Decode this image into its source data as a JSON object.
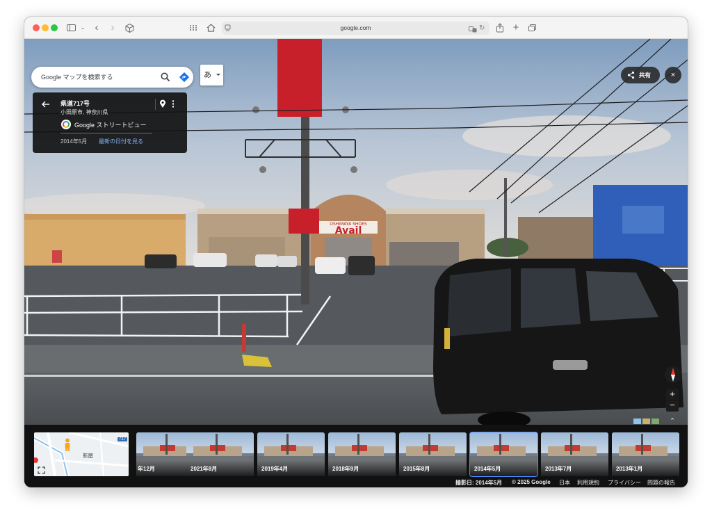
{
  "browser": {
    "url": "google.com"
  },
  "maps": {
    "search_placeholder": "Google マップを検索する",
    "ime_label": "あ",
    "share_label": "共有",
    "close_glyph": "×"
  },
  "location_card": {
    "title": "県道717号",
    "subtitle": "小田原市, 神奈川県",
    "brand": "Google ストリートビュー",
    "capture_date": "2014年5月",
    "latest_link": "最新の日付を見る"
  },
  "controls": {
    "zoom_in": "+",
    "zoom_out": "−",
    "expand_glyph": "⌃"
  },
  "minimap": {
    "place_label": "新屋",
    "road_number": "717"
  },
  "timeline": [
    {
      "label": "年12月",
      "selected": false
    },
    {
      "label": "2021年8月",
      "selected": false
    },
    {
      "label": "2019年4月",
      "selected": false
    },
    {
      "label": "2018年9月",
      "selected": false
    },
    {
      "label": "2015年8月",
      "selected": false
    },
    {
      "label": "2014年5月",
      "selected": true
    },
    {
      "label": "2013年7月",
      "selected": false
    },
    {
      "label": "2013年1月",
      "selected": false
    }
  ],
  "footer": {
    "capture": "撮影日: 2014年5月",
    "copyright": "© 2025 Google",
    "region": "日本",
    "terms": "利用規約",
    "privacy": "プライバシー",
    "report": "問題の報告"
  },
  "scene": {
    "store_sign_top": "OSHIMAYA SHOES",
    "store_sign": "Avail"
  },
  "colors": {
    "accent_blue": "#4a8cff",
    "link_blue": "#8ab4f8",
    "sign_red": "#c8202a"
  }
}
